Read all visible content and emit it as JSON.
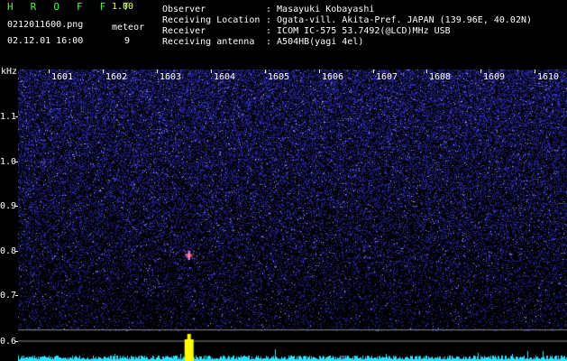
{
  "header": {
    "title_letters": [
      "H",
      "R",
      "O",
      "F",
      "F",
      "T"
    ],
    "version": "1.00",
    "filename": "0212011600.png",
    "datetime": "02.12.01 16:00",
    "meteor_label": "meteor",
    "meteor_count": "9"
  },
  "info": {
    "rows": [
      {
        "label": "Observer",
        "value": ": Masayuki Kobayashi"
      },
      {
        "label": "Receiving Location",
        "value": ": Ogata-vill. Akita-Pref. JAPAN (139.96E, 40.02N)"
      },
      {
        "label": "Receiver",
        "value": ": ICOM IC-575 53.7492(@LCD)MHz USB"
      },
      {
        "label": "Receiving antenna",
        "value": ": A504HB(yagi 4el)"
      }
    ]
  },
  "axes": {
    "y_unit": "kHz",
    "y_ticks": [
      "1.1",
      "1.0",
      "0.9",
      "0.8",
      "0.7",
      "0.6"
    ],
    "x_ticks": [
      "1601",
      "1602",
      "1603",
      "1604",
      "1605",
      "1606",
      "1607",
      "1608",
      "1609",
      "1610"
    ]
  },
  "colors": {
    "background": "#000000",
    "noise_dark": "#0a0a60",
    "noise_bright": "#5050ff",
    "signal": "#ff4040",
    "baseline": "#30e0ff",
    "burst": "#ffff00",
    "guide_line": "#888888"
  },
  "meteors": [
    {
      "minute": 1603.6,
      "freq_khz": 0.79,
      "strength": 1.0
    }
  ]
}
